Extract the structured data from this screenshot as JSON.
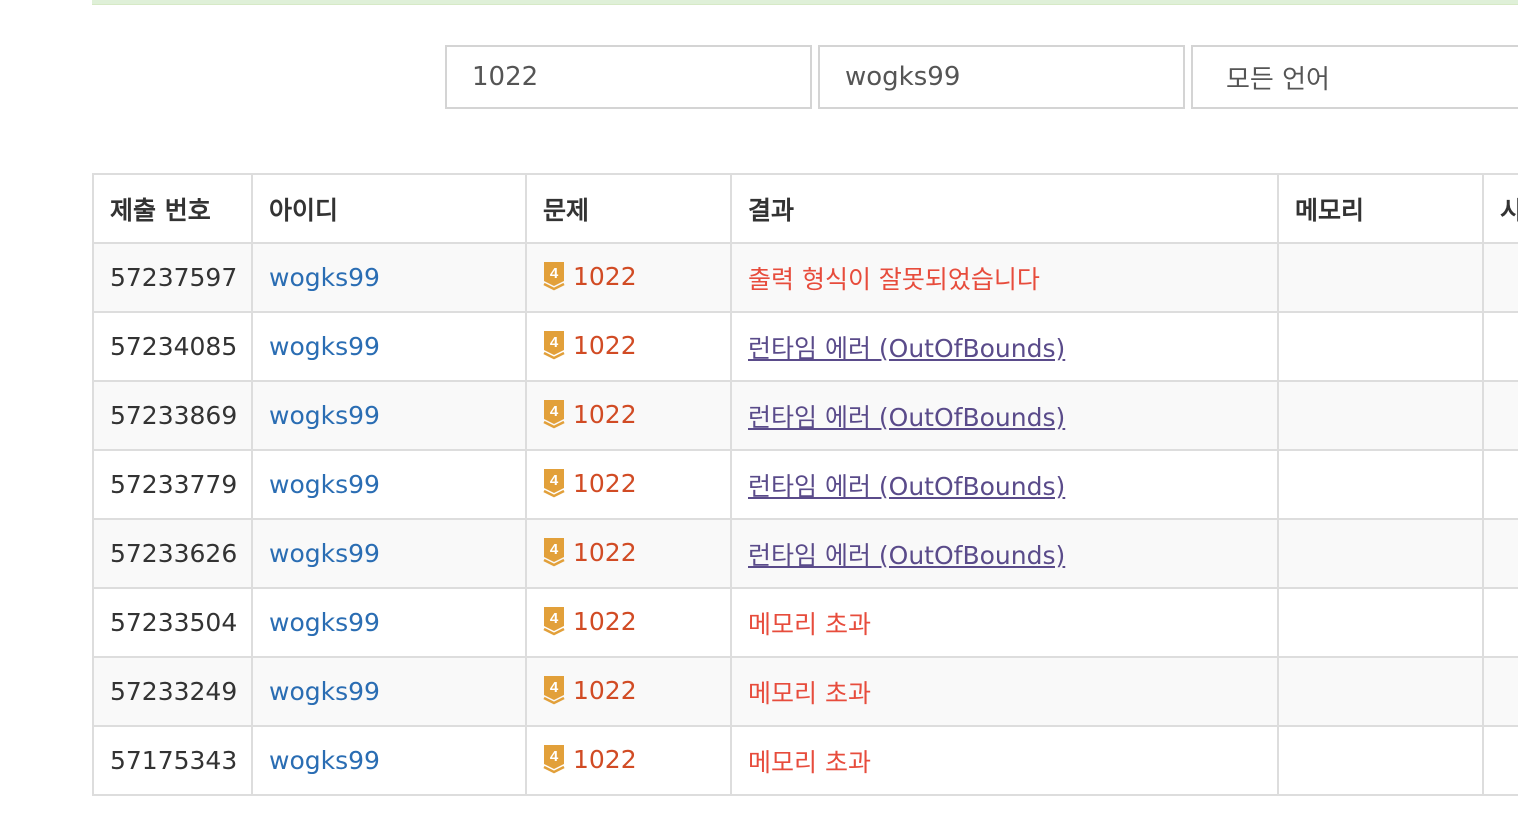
{
  "filters": {
    "problem_id": "1022",
    "user_id": "wogks99",
    "language": "모든 언어"
  },
  "table": {
    "headers": [
      "제출 번호",
      "아이디",
      "문제",
      "결과",
      "메모리",
      "시"
    ],
    "rows": [
      {
        "submission": "57237597",
        "user": "wogks99",
        "tier": "4",
        "problem": "1022",
        "result": "출력 형식이 잘못되었습니다",
        "result_type": "presentation-error"
      },
      {
        "submission": "57234085",
        "user": "wogks99",
        "tier": "4",
        "problem": "1022",
        "result": "런타임 에러 (OutOfBounds)",
        "result_type": "runtime-error"
      },
      {
        "submission": "57233869",
        "user": "wogks99",
        "tier": "4",
        "problem": "1022",
        "result": "런타임 에러 (OutOfBounds)",
        "result_type": "runtime-error"
      },
      {
        "submission": "57233779",
        "user": "wogks99",
        "tier": "4",
        "problem": "1022",
        "result": "런타임 에러 (OutOfBounds)",
        "result_type": "runtime-error"
      },
      {
        "submission": "57233626",
        "user": "wogks99",
        "tier": "4",
        "problem": "1022",
        "result": "런타임 에러 (OutOfBounds)",
        "result_type": "runtime-error"
      },
      {
        "submission": "57233504",
        "user": "wogks99",
        "tier": "4",
        "problem": "1022",
        "result": "메모리 초과",
        "result_type": "memory-limit"
      },
      {
        "submission": "57233249",
        "user": "wogks99",
        "tier": "4",
        "problem": "1022",
        "result": "메모리 초과",
        "result_type": "memory-limit"
      },
      {
        "submission": "57175343",
        "user": "wogks99",
        "tier": "4",
        "problem": "1022",
        "result": "메모리 초과",
        "result_type": "memory-limit"
      }
    ]
  },
  "colors": {
    "user_link": "#2a6db3",
    "problem_link": "#d14b24",
    "error_text": "#e74c3c",
    "runtime_error_link": "#5a4b8a",
    "tier_badge": "#e2a03a"
  },
  "icons": {
    "tier": "gold-tier-badge-icon",
    "dropdown": "chevron-down-icon"
  }
}
